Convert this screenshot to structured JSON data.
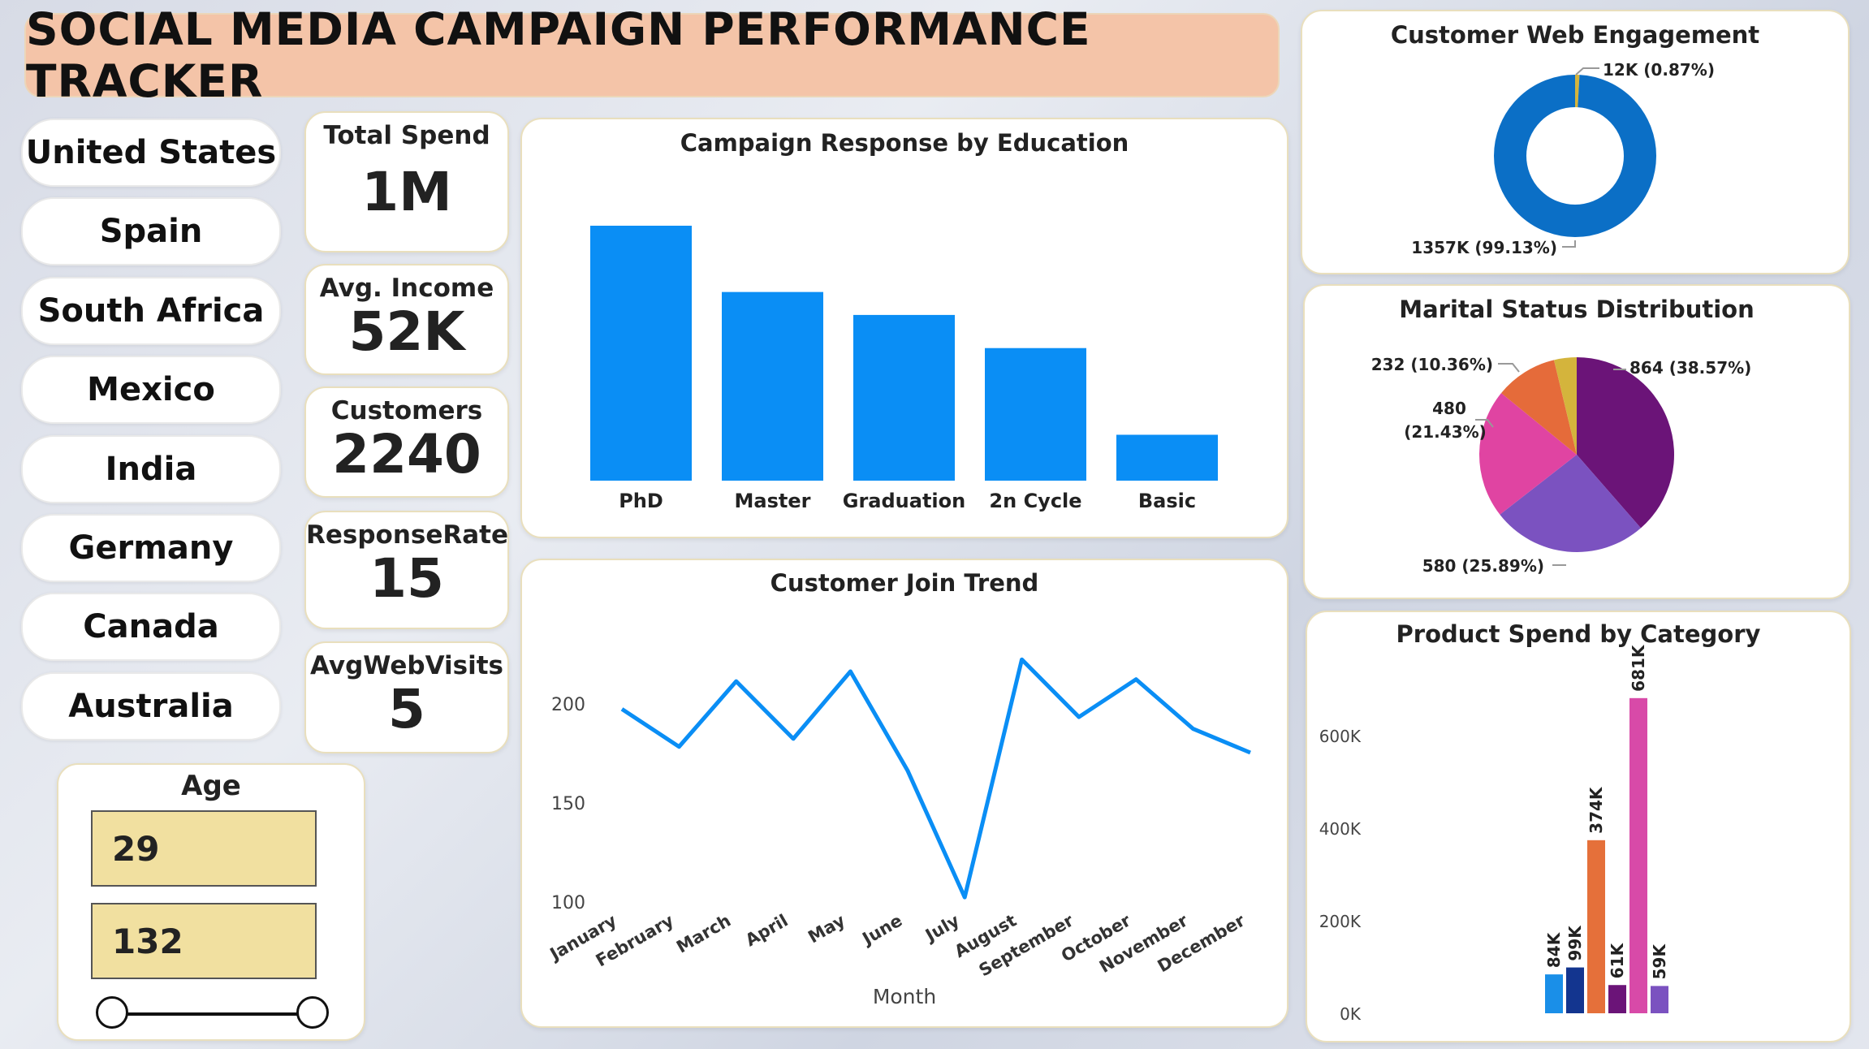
{
  "title": "SOCIAL MEDIA CAMPAIGN PERFORMANCE TRACKER",
  "countries": [
    "United States",
    "Spain",
    "South Africa",
    "Mexico",
    "India",
    "Germany",
    "Canada",
    "Australia"
  ],
  "kpis": {
    "total_spend": {
      "label": "Total Spend",
      "value": "1M"
    },
    "avg_income": {
      "label": "Avg. Income",
      "value": "52K"
    },
    "customers": {
      "label": "Customers",
      "value": "2240"
    },
    "response_rate": {
      "label": "ResponseRate",
      "value": "15"
    },
    "avg_web_visits": {
      "label": "AvgWebVisits",
      "value": "5"
    }
  },
  "age_filter": {
    "label": "Age",
    "min": "29",
    "max": "132"
  },
  "colors": {
    "primary_blue": "#0a8ef5",
    "dark_blue": "#0b6fc6",
    "title_bg": "#f4c4a8"
  },
  "chart_data": [
    {
      "type": "bar",
      "title": "Campaign Response by Education",
      "categories": [
        "PhD",
        "Master",
        "Graduation",
        "2n Cycle",
        "Basic"
      ],
      "values": [
        100,
        74,
        65,
        52,
        18
      ]
    },
    {
      "type": "line",
      "title": "Customer Join Trend",
      "xlabel": "Month",
      "categories": [
        "January",
        "February",
        "March",
        "April",
        "May",
        "June",
        "July",
        "August",
        "September",
        "October",
        "November",
        "December"
      ],
      "values": [
        197,
        178,
        211,
        182,
        216,
        166,
        102,
        222,
        193,
        212,
        187,
        175
      ],
      "ylim": [
        100,
        225
      ],
      "yticks": [
        100,
        150,
        200
      ]
    },
    {
      "type": "pie",
      "subtype": "donut",
      "title": "Customer Web Engagement",
      "slices": [
        {
          "label": "12K (0.87%)",
          "value": 0.87,
          "color": "#d4b43c"
        },
        {
          "label": "1357K (99.13%)",
          "value": 99.13,
          "color": "#0b6fc6"
        }
      ]
    },
    {
      "type": "pie",
      "title": "Marital Status Distribution",
      "slices": [
        {
          "label": "864 (38.57%)",
          "value": 38.57,
          "color": "#6b1478"
        },
        {
          "label": "580 (25.89%)",
          "value": 25.89,
          "color": "#7b52c0"
        },
        {
          "label": "480",
          "label2": "(21.43%)",
          "value": 21.43,
          "color": "#e044a2"
        },
        {
          "label": "232 (10.36%)",
          "value": 10.36,
          "color": "#e56b3a"
        },
        {
          "label": "",
          "value": 3.75,
          "color": "#d4b43c"
        }
      ]
    },
    {
      "type": "bar",
      "title": "Product Spend by Category",
      "ylim": [
        0,
        700000
      ],
      "yticks": [
        "0K",
        "200K",
        "400K",
        "600K"
      ],
      "bars": [
        {
          "label": "84K",
          "value": 84000,
          "color": "#1a8fe8"
        },
        {
          "label": "99K",
          "value": 99000,
          "color": "#13358f"
        },
        {
          "label": "374K",
          "value": 374000,
          "color": "#e5703a"
        },
        {
          "label": "61K",
          "value": 61000,
          "color": "#6b1478"
        },
        {
          "label": "681K",
          "value": 681000,
          "color": "#d84aa8"
        },
        {
          "label": "59K",
          "value": 59000,
          "color": "#7b52c0"
        }
      ]
    }
  ]
}
